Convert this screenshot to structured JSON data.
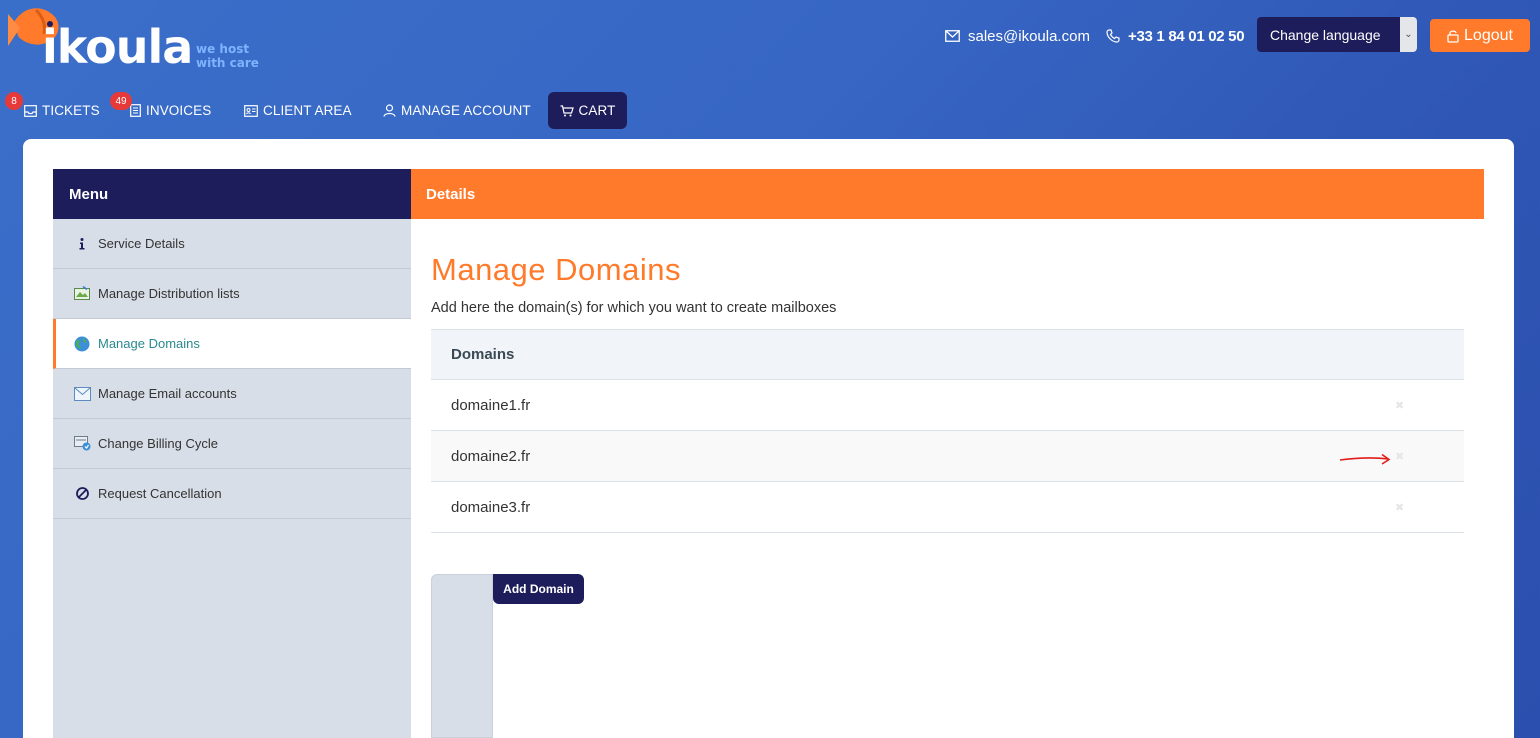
{
  "brand": {
    "name": "ikoula",
    "tagline_line1": "we host",
    "tagline_line2": "with care"
  },
  "header": {
    "email": "sales@ikoula.com",
    "phone": "+33 1 84 01 02 50",
    "language_label": "Change language",
    "logout_label": "Logout"
  },
  "nav": {
    "tickets": {
      "label": "TICKETS",
      "badge": "8"
    },
    "invoices": {
      "label": "INVOICES",
      "badge": "49"
    },
    "client_area": {
      "label": "CLIENT AREA"
    },
    "manage_account": {
      "label": "MANAGE ACCOUNT"
    },
    "cart": {
      "label": "CART"
    }
  },
  "menu": {
    "title": "Menu",
    "items": [
      {
        "label": "Service Details",
        "icon": "info-icon"
      },
      {
        "label": "Manage Distribution lists",
        "icon": "distribution-list-icon"
      },
      {
        "label": "Manage Domains",
        "icon": "globe-icon",
        "active": true
      },
      {
        "label": "Manage Email accounts",
        "icon": "email-icon"
      },
      {
        "label": "Change Billing Cycle",
        "icon": "billing-cycle-icon"
      },
      {
        "label": "Request Cancellation",
        "icon": "cancel-icon"
      }
    ]
  },
  "details": {
    "title": "Details",
    "page_title": "Manage Domains",
    "subtitle": "Add here the domain(s) for which you want to create mailboxes",
    "table_header": "Domains",
    "domains": [
      "domaine1.fr",
      "domaine2.fr",
      "domaine3.fr"
    ],
    "add_button": "Add Domain"
  },
  "colors": {
    "accent": "#ff7a2a",
    "navy": "#1e1d5c",
    "badge": "#e63a3a"
  }
}
